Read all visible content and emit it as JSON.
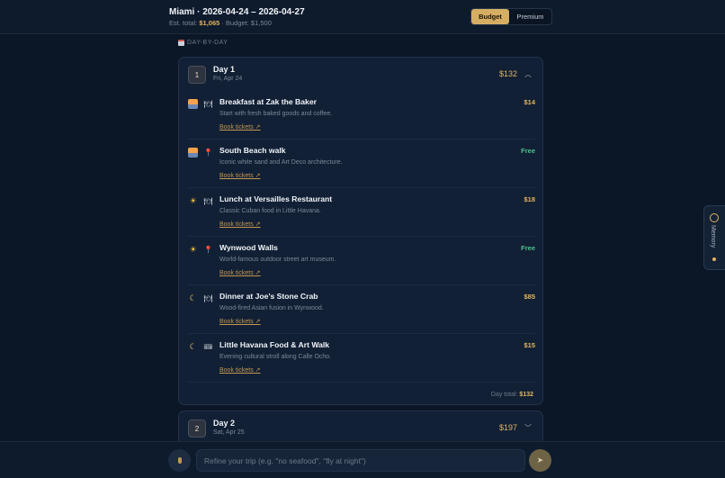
{
  "header": {
    "trip_title": "Miami · 2026-04-24 – 2026-04-27",
    "est_label": "Est. total:",
    "est_value": "$1,065",
    "budget_label": "· Budget: $1,500",
    "mode_options": [
      "Budget",
      "Premium"
    ],
    "selected_mode": "Budget"
  },
  "section_label": "DAY-BY-DAY",
  "days": [
    {
      "number": "1",
      "name": "Day 1",
      "date": "Fri, Apr 24",
      "cost": "$132",
      "expanded": true,
      "total_label": "Day total:",
      "total_value": "$132",
      "activities": [
        {
          "title": "Breakfast at Zak the Baker",
          "desc": "Start with fresh baked goods and coffee.",
          "link": "Book tickets ↗",
          "price": "$14",
          "time_icon": "sunrise-icon",
          "type_icon": "dining-icon"
        },
        {
          "title": "South Beach walk",
          "desc": "Iconic white sand and Art Deco architecture.",
          "link": "Book tickets ↗",
          "price": "Free",
          "time_icon": "sunrise-icon",
          "type_icon": "pin-icon"
        },
        {
          "title": "Lunch at Versailles Restaurant",
          "desc": "Classic Cuban food in Little Havana.",
          "link": "Book tickets ↗",
          "price": "$18",
          "time_icon": "sun-icon",
          "type_icon": "dining-icon"
        },
        {
          "title": "Wynwood Walls",
          "desc": "World-famous outdoor street art museum.",
          "link": "Book tickets ↗",
          "price": "Free",
          "time_icon": "sun-icon",
          "type_icon": "pin-icon"
        },
        {
          "title": "Dinner at Joe's Stone Crab",
          "desc": "Wood-fired Asian fusion in Wynwood.",
          "link": "Book tickets ↗",
          "price": "$85",
          "time_icon": "moon-icon",
          "type_icon": "dining-icon"
        },
        {
          "title": "Little Havana Food & Art Walk",
          "desc": "Evening cultural stroll along Calle Ocho.",
          "link": "Book tickets ↗",
          "price": "$15",
          "time_icon": "moon-icon",
          "type_icon": "ticket-icon"
        }
      ]
    },
    {
      "number": "2",
      "name": "Day 2",
      "date": "Sat, Apr 25",
      "cost": "$197",
      "expanded": false
    }
  ],
  "input": {
    "placeholder": "Refine your trip (e.g. \"no seafood\", \"fly at night\")",
    "value": ""
  },
  "memory_label": "Memory",
  "colors": {
    "accent": "#e0b460",
    "free": "#4fc08d",
    "background": "#0b1626",
    "card": "#122035"
  }
}
